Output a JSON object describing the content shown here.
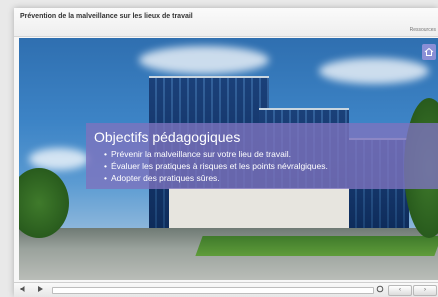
{
  "window": {
    "title": "Prévention de la malveillance sur les lieux de travail",
    "resources_label": "Ressources"
  },
  "slide": {
    "heading": "Objectifs pédagogiques",
    "bullets": [
      "Prévenir la malveillance sur votre lieu de travail.",
      "Évaluer les pratiques à risques et les points névralgiques.",
      "Adopter des pratiques sûres."
    ]
  },
  "icons": {
    "home": "home-icon",
    "volume": "volume-icon",
    "play": "play-icon",
    "replay": "replay-icon",
    "prev": "chevron-left-icon",
    "next": "chevron-right-icon"
  },
  "controls": {
    "prev_label": "‹",
    "next_label": "›"
  },
  "colors": {
    "overlay": "#7D73BE",
    "home_button": "#8A8FD6"
  }
}
